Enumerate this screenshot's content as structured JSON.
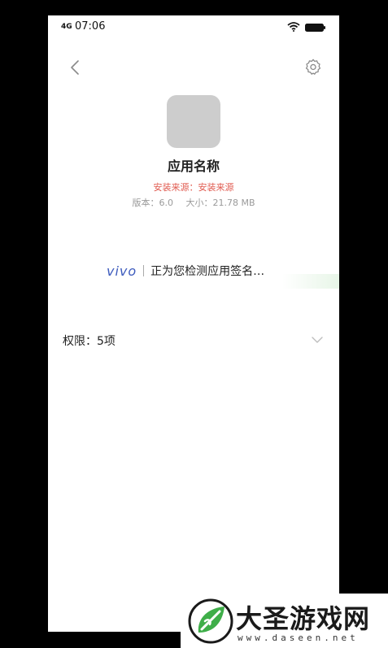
{
  "status_bar": {
    "signal_text": "4G",
    "time": "07:06"
  },
  "header": {
    "back_icon": "chevron-left-icon",
    "settings_icon": "gear-icon"
  },
  "app": {
    "name": "应用名称",
    "install_source": "安装来源：安装来源",
    "version_label": "版本：6.0",
    "size_label": "大小：21.78 MB"
  },
  "check": {
    "brand": "vivo",
    "status_text": "正为您检测应用签名…",
    "brand_color": "#3d5bbd"
  },
  "permissions": {
    "label": "权限：5项",
    "icon": "chevron-down-icon"
  },
  "watermark": {
    "title": "大圣游戏网",
    "url": "www.daseen.net"
  }
}
